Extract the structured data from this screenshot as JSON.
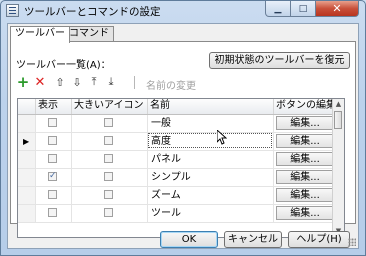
{
  "window": {
    "title": "ツールバーとコマンドの設定"
  },
  "tabs": [
    {
      "label": "ツールバー",
      "active": true
    },
    {
      "label": "コマンド",
      "active": false
    }
  ],
  "list_label": "ツールバー一覧(A)：",
  "restore_button": "初期状態のツールバーを復元",
  "toolbar": {
    "rename_label": "名前の変更"
  },
  "table": {
    "headers": [
      "表示",
      "大きいアイコン",
      "名前",
      "ボタンの編集"
    ],
    "rows": [
      {
        "show": false,
        "large": false,
        "name": "一般",
        "edit": "編集...",
        "current": false
      },
      {
        "show": false,
        "large": false,
        "name": "高度",
        "edit": "編集...",
        "current": true
      },
      {
        "show": false,
        "large": false,
        "name": "パネル",
        "edit": "編集...",
        "current": false
      },
      {
        "show": true,
        "large": false,
        "name": "シンプル",
        "edit": "編集...",
        "current": false
      },
      {
        "show": false,
        "large": false,
        "name": "ズーム",
        "edit": "編集...",
        "current": false
      },
      {
        "show": false,
        "large": false,
        "name": "ツール",
        "edit": "編集...",
        "current": false
      }
    ]
  },
  "buttons": {
    "ok": "OK",
    "cancel": "キャンセル",
    "help": "ヘルプ(H)"
  },
  "colors": {
    "accent": "#3c7fb1",
    "add_icon": "#2b9a2b",
    "delete_icon": "#dd2222"
  }
}
